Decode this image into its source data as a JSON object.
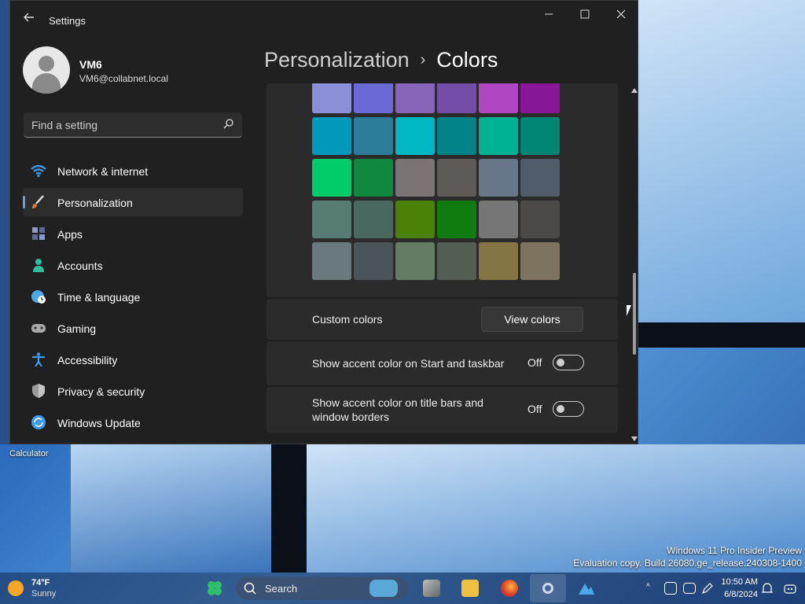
{
  "window": {
    "title": "Settings",
    "back_icon": "back-arrow-icon",
    "controls": [
      "minimize-icon",
      "maximize-icon",
      "close-icon"
    ]
  },
  "profile": {
    "name": "VM6",
    "email": "VM6@collabnet.local"
  },
  "search": {
    "placeholder": "Find a setting"
  },
  "sidebar": {
    "items": [
      {
        "label": "Network & internet",
        "icon": "wifi-icon",
        "color": "#3d9be9"
      },
      {
        "label": "Personalization",
        "icon": "brush-icon",
        "color": "#e0e0e0",
        "active": true
      },
      {
        "label": "Apps",
        "icon": "apps-icon",
        "color": "#6b7fa8"
      },
      {
        "label": "Accounts",
        "icon": "person-icon",
        "color": "#2fbf9e"
      },
      {
        "label": "Time & language",
        "icon": "globe-clock-icon",
        "color": "#4aa8e8"
      },
      {
        "label": "Gaming",
        "icon": "gamepad-icon",
        "color": "#a8a8a8"
      },
      {
        "label": "Accessibility",
        "icon": "accessibility-icon",
        "color": "#3d9be9"
      },
      {
        "label": "Privacy & security",
        "icon": "shield-icon",
        "color": "#9a9a9a"
      },
      {
        "label": "Windows Update",
        "icon": "update-icon",
        "color": "#3d9be9"
      }
    ]
  },
  "breadcrumb": {
    "parent": "Personalization",
    "separator": "›",
    "current": "Colors"
  },
  "colors": {
    "swatches": [
      [
        "#8b8fd8",
        "#6b69d6",
        "#8764b8",
        "#744da9",
        "#b146c2",
        "#881798"
      ],
      [
        "#0099bc",
        "#2d7d9a",
        "#00b7c3",
        "#038387",
        "#00b294",
        "#018574"
      ],
      [
        "#00cc6a",
        "#10893e",
        "#7a7574",
        "#5d5a58",
        "#68768a",
        "#515c6b"
      ],
      [
        "#567c73",
        "#486860",
        "#498205",
        "#107c10",
        "#767676",
        "#4c4a48"
      ],
      [
        "#69797e",
        "#4a5459",
        "#647c64",
        "#525e54",
        "#847545",
        "#7e735f"
      ]
    ]
  },
  "custom_colors": {
    "label": "Custom colors",
    "button": "View colors"
  },
  "accent_start": {
    "label": "Show accent color on Start and taskbar",
    "state": "Off"
  },
  "accent_title": {
    "label_1": "Show accent color on title bars and",
    "label_2": "window borders",
    "state": "Off"
  },
  "desktop": {
    "calculator_label": "Calculator",
    "watermark_1": "Windows 11 Pro Insider Preview",
    "watermark_2": "Evaluation copy. Build 26080.ge_release.240308-1400"
  },
  "taskbar": {
    "temp": "74°F",
    "condition": "Sunny",
    "search_placeholder": "Search",
    "time": "10:50 AM",
    "date": "6/8/2024"
  }
}
